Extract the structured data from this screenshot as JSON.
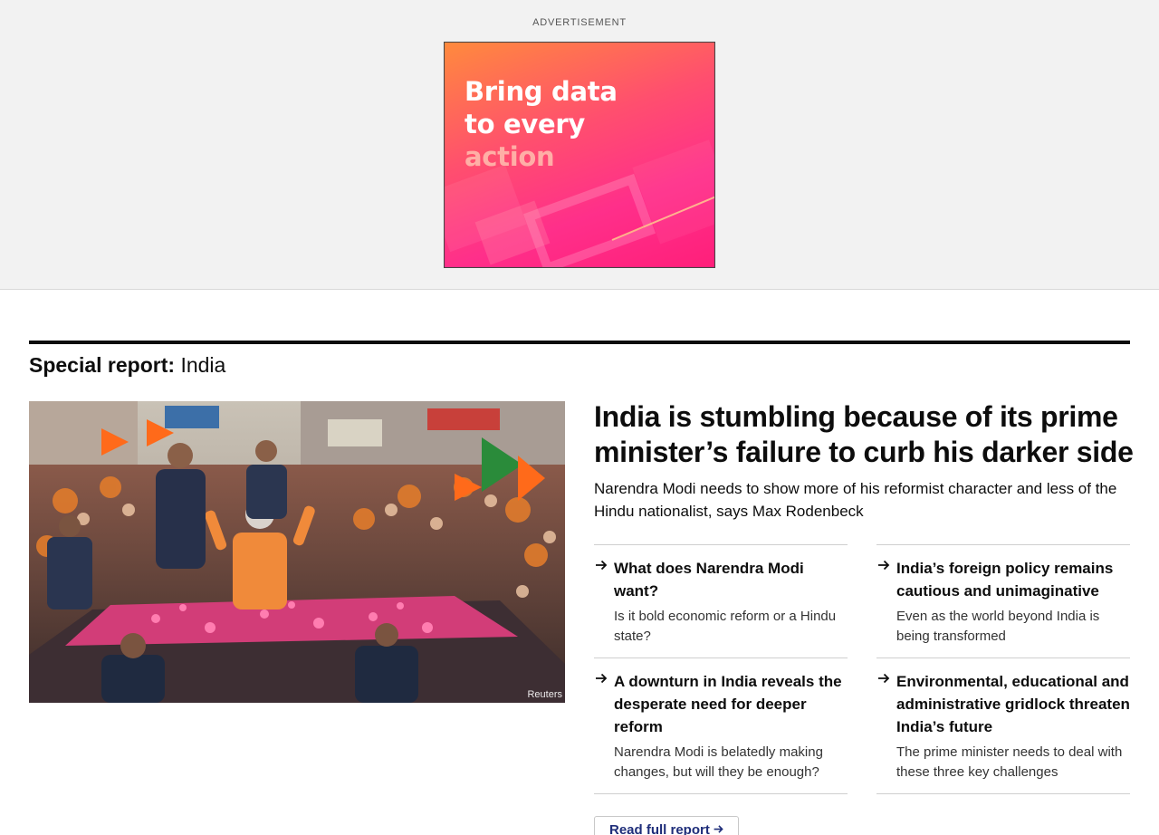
{
  "ad": {
    "label": "ADVERTISEMENT",
    "line1": "Bring data",
    "line2": "to every",
    "line3": "action"
  },
  "section": {
    "kicker": "Special report:",
    "topic": "India"
  },
  "hero": {
    "credit": "Reuters"
  },
  "lead": {
    "headline": "India is stumbling because of its prime minister’s failure to curb his darker side",
    "standfirst": "Narendra Modi needs to show more of his reformist character and less of the Hindu nationalist, says Max Rodenbeck"
  },
  "articles": [
    {
      "title": "What does Narendra Modi want?",
      "description": "Is it bold economic reform or a Hindu state?"
    },
    {
      "title": "India’s foreign policy remains cautious and unimaginative",
      "description": "Even as the world beyond India is being transformed"
    },
    {
      "title": "A downturn in India reveals the desperate need for deeper reform",
      "description": "Narendra Modi is belatedly making changes, but will they be enough?"
    },
    {
      "title": "Environmental, educational and administrative gridlock threaten India’s future",
      "description": "The prime minister needs to deal with these three key challenges"
    }
  ],
  "read_full_report": "Read full report",
  "colors": {
    "text": "#0d0d0d",
    "link_button": "#1f2e7a",
    "ad_gradient_start": "#ff8a3d",
    "ad_gradient_end": "#ff1f7a"
  }
}
